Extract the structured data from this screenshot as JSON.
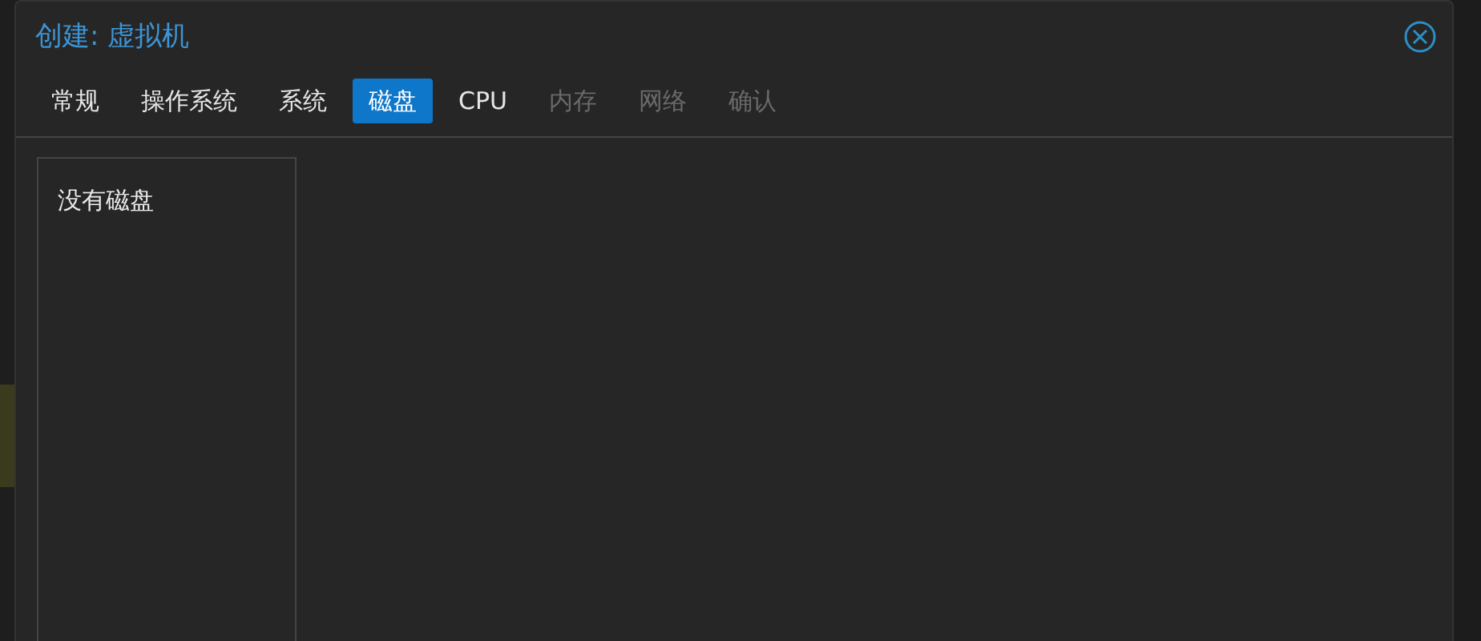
{
  "window": {
    "title": "创建: 虚拟机"
  },
  "tabs": [
    {
      "label": "常规",
      "selected": false,
      "disabled": false
    },
    {
      "label": "操作系统",
      "selected": false,
      "disabled": false
    },
    {
      "label": "系统",
      "selected": false,
      "disabled": false
    },
    {
      "label": "磁盘",
      "selected": true,
      "disabled": false
    },
    {
      "label": "CPU",
      "selected": false,
      "disabled": false
    },
    {
      "label": "内存",
      "selected": false,
      "disabled": true
    },
    {
      "label": "网络",
      "selected": false,
      "disabled": true
    },
    {
      "label": "确认",
      "selected": false,
      "disabled": true
    }
  ],
  "disk_list": {
    "empty_text": "没有磁盘"
  }
}
